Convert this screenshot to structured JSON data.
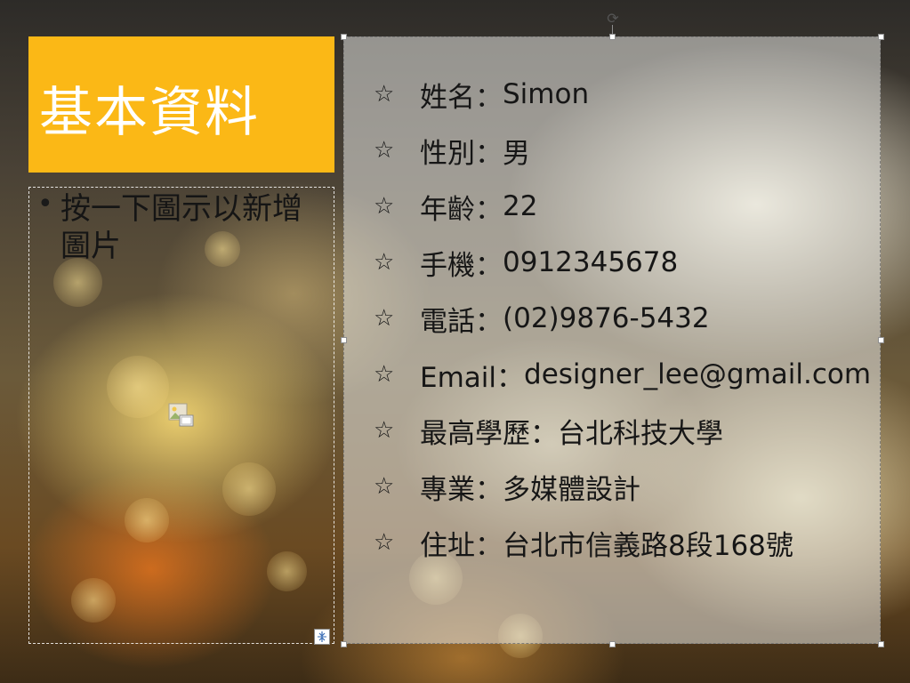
{
  "slide": {
    "title": "基本資料",
    "placeholder_bullet": "•",
    "placeholder_hint": "按一下圖示以新增圖片",
    "star_glyph": "☆",
    "info_items": [
      {
        "label": "姓名：",
        "value": "Simon"
      },
      {
        "label": "性別：",
        "value": "男"
      },
      {
        "label": "年齡：",
        "value": "22"
      },
      {
        "label": "手機：",
        "value": "0912345678"
      },
      {
        "label": "電話：",
        "value": "(02)9876-5432"
      },
      {
        "label": "Email：",
        "value": "designer_lee@gmail.com"
      },
      {
        "label": "最高學歷：",
        "value": "台北科技大學"
      },
      {
        "label": "專業：",
        "value": "多媒體設計"
      },
      {
        "label": "住址：",
        "value": "台北市信義路8段168號"
      }
    ]
  },
  "colors": {
    "title_box": "#fbb816",
    "title_text": "#ffffff",
    "body_text": "#161616"
  },
  "icons": {
    "rotate": "rotate-handle-icon",
    "picture": "insert-picture-icon",
    "autofit": "autofit-options-icon"
  }
}
